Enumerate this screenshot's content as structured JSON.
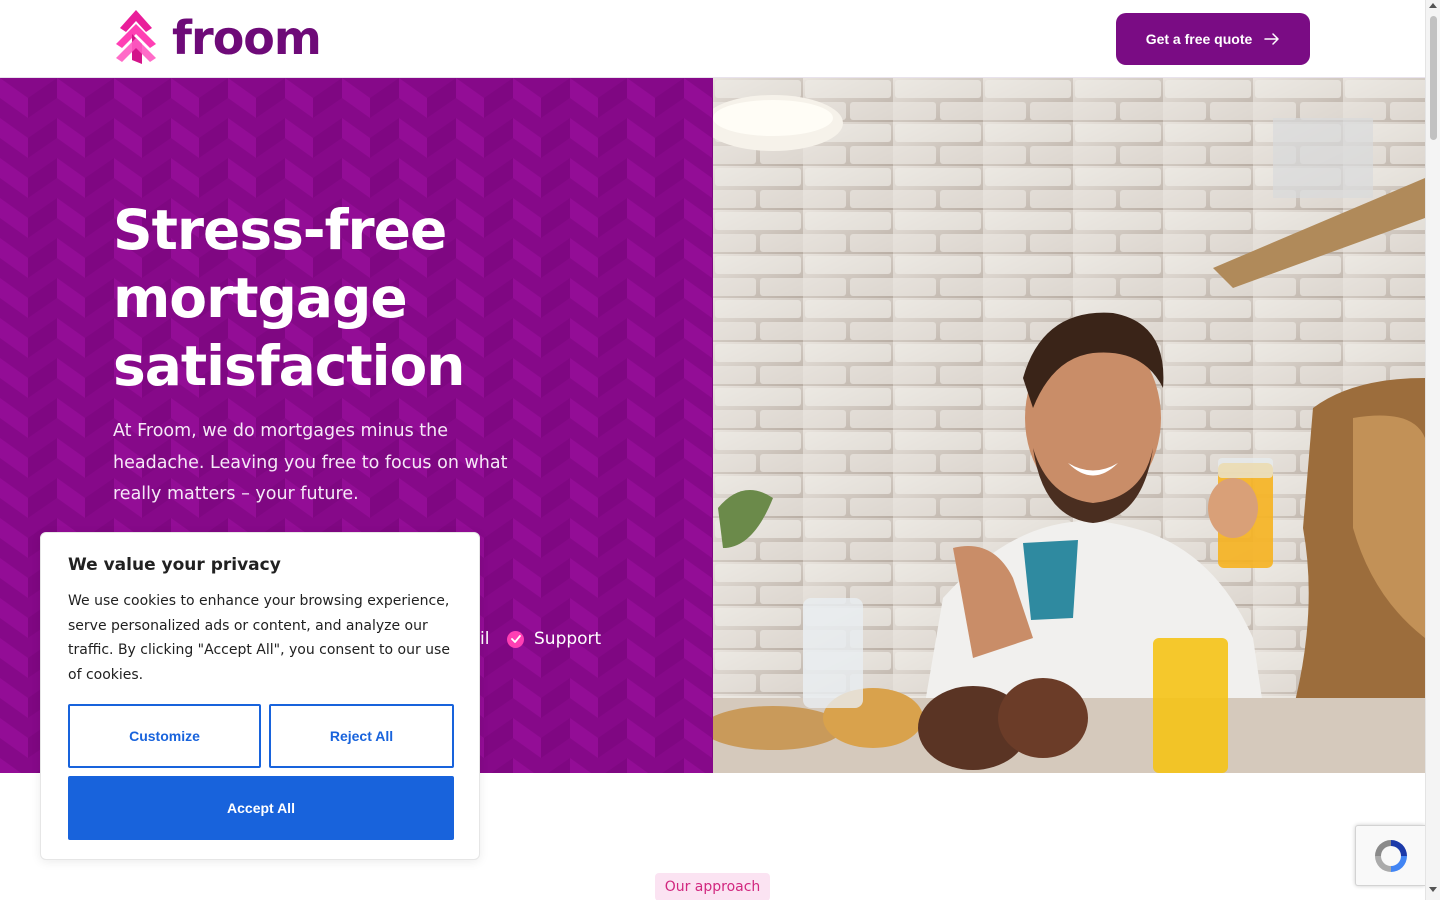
{
  "brand": {
    "name": "froom",
    "logo_icon": "arrow-chevron-logo-icon",
    "primary_color": "#7a0c84",
    "accent_color": "#ff3fb4"
  },
  "header": {
    "cta_label": "Get a free quote",
    "cta_icon": "arrow-right-icon"
  },
  "hero": {
    "title": "Stress-free mortgage satisfaction",
    "subtitle": "At Froom, we do mortgages minus the headache. Leaving you free to focus on what really matters – your future.",
    "background_color": "#8a0a8e",
    "features": [
      {
        "partial_label": "il"
      },
      {
        "label": "Support",
        "icon": "check-circle-icon"
      }
    ],
    "image_subject": "couple-breakfast-photo"
  },
  "section": {
    "badge": "Our approach"
  },
  "cookie_banner": {
    "title": "We value your privacy",
    "text": "We use cookies to enhance your browsing experience, serve personalized ads or content, and analyze our traffic. By clicking \"Accept All\", you consent to our use of cookies.",
    "customize_label": "Customize",
    "reject_label": "Reject All",
    "accept_label": "Accept All",
    "button_color": "#1863dc"
  },
  "recaptcha": {
    "icon": "recaptcha-icon"
  }
}
